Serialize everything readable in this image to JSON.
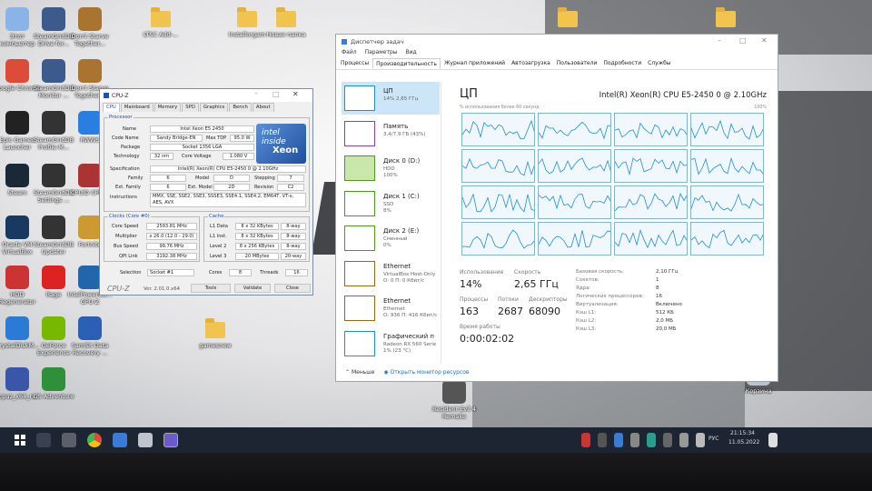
{
  "desktop": {
    "icons": [
      {
        "label": "Этот компьютер",
        "color": "#8ab4e8"
      },
      {
        "label": "SteamGridDB Drive for...",
        "color": "#3c5a8c"
      },
      {
        "label": "Don't Starve Together...",
        "color": "#a8742f"
      },
      {
        "label": "Google Chrome",
        "color": "#dd4b39"
      },
      {
        "label": "SteamGridDB Monitor ...",
        "color": "#3c5a8c"
      },
      {
        "label": "Don't Starve Together...",
        "color": "#a8742f"
      },
      {
        "label": "Epic Games Launcher",
        "color": "#222"
      },
      {
        "label": "SteamGridDB Profile M...",
        "color": "#333"
      },
      {
        "label": "RWWS",
        "color": "#2a7de1"
      },
      {
        "label": "Steam",
        "color": "#1b2838"
      },
      {
        "label": "SteamGridDB Settings ...",
        "color": "#333"
      },
      {
        "label": "CPUID CPU-Z",
        "color": "#a33"
      },
      {
        "label": "Oracle VM VirtualBox",
        "color": "#183a61"
      },
      {
        "label": "SteamGridDB Updater",
        "color": "#333"
      },
      {
        "label": "Fortnite",
        "color": "#c93"
      },
      {
        "label": "HDD Regenerator",
        "color": "#c33"
      },
      {
        "label": "Rage",
        "color": "#d22"
      },
      {
        "label": "IntelPowerGa... GPU-Z",
        "color": "#2266aa"
      },
      {
        "label": "CrystalDiskM...",
        "color": "#2b7bd6"
      },
      {
        "label": "GeForce Experience",
        "color": "#76b900"
      },
      {
        "label": "SamSit Data Recovery ...",
        "color": "#2b5fb5"
      },
      {
        "label": "cpuz_x64_ru",
        "color": "#3a56a8"
      },
      {
        "label": "GS Adventure",
        "color": "#2f8f3a"
      }
    ],
    "folders": [
      {
        "label": "LTSC Add-..."
      },
      {
        "label": "Installorgam"
      },
      {
        "label": "Новая папка"
      },
      {
        "label": "gamesnew"
      }
    ],
    "recycle_label": "Корзина",
    "resident_label": "Resident Evil 4 Remake"
  },
  "cpuz": {
    "title": "CPU-Z",
    "tabs": [
      "CPU",
      "Mainboard",
      "Memory",
      "SPD",
      "Graphics",
      "Bench",
      "About"
    ],
    "processor_legend": "Processor",
    "name": "Intel Xeon E5 2450",
    "code_name": "Sandy Bridge-EN",
    "max_tdp": "95.0 W",
    "package": "Socket 1356 LGA",
    "technology": "32 nm",
    "core_voltage": "1.080 V",
    "specification": "Intel(R) Xeon(R) CPU E5-2450 0 @ 2.10GHz",
    "family": "6",
    "model": "D",
    "stepping": "7",
    "ext_family": "6",
    "ext_model": "2D",
    "revision": "C2",
    "instructions": "MMX, SSE, SSE2, SSE3, SSSE3, SSE4.1, SSE4.2, EM64T, VT-x, AES, AVX",
    "clocks_legend": "Clocks (Core #0)",
    "core_speed": "2593.81 MHz",
    "multiplier": "x 26.0 (12.0 - 29.0)",
    "bus_speed": "99.76 MHz",
    "qpi_link": "3192.38 MHz",
    "cache_legend": "Cache",
    "l1_data": "8 x 32 KBytes",
    "l1_data_way": "8-way",
    "l1_inst": "8 x 32 KBytes",
    "l1_inst_way": "8-way",
    "level2": "8 x 256 KBytes",
    "level2_way": "8-way",
    "level3": "20 MBytes",
    "level3_way": "20-way",
    "selection_label": "Selection",
    "selection": "Socket #1",
    "cores_label": "Cores",
    "cores": "8",
    "threads_label": "Threads",
    "threads": "16",
    "brand": "CPU-Z",
    "version": "Ver. 2.01.0.x64",
    "tools_btn": "Tools",
    "validate_btn": "Validate",
    "close_btn": "Close",
    "labels": {
      "name": "Name",
      "code_name": "Code Name",
      "max_tdp": "Max TDP",
      "package": "Package",
      "technology": "Technology",
      "core_voltage": "Core Voltage",
      "specification": "Specification",
      "family": "Family",
      "model": "Model",
      "stepping": "Stepping",
      "ext_family": "Ext. Family",
      "ext_model": "Ext. Model",
      "revision": "Revision",
      "instructions": "Instructions",
      "core_speed": "Core Speed",
      "multiplier": "Multiplier",
      "bus_speed": "Bus Speed",
      "qpi_link": "QPI Link",
      "l1_data": "L1 Data",
      "l1_inst": "L1 Inst.",
      "level2": "Level 2",
      "level3": "Level 3"
    },
    "badge_top": "intel inside",
    "badge_bottom": "Xeon"
  },
  "taskmgr": {
    "title": "Диспетчер задач",
    "menu": [
      "Файл",
      "Параметры",
      "Вид"
    ],
    "tabs": [
      "Процессы",
      "Производительность",
      "Журнал приложений",
      "Автозагрузка",
      "Пользователи",
      "Подробности",
      "Службы"
    ],
    "sidebar": [
      {
        "t1": "ЦП",
        "t2": "14% 2,65 ГГц",
        "t3": "",
        "color": "#1f8fd1"
      },
      {
        "t1": "Память",
        "t2": "3,4/7,9 ГБ (43%)",
        "t3": "",
        "color": "#8b3fa8"
      },
      {
        "t1": "Диск 0 (D:)",
        "t2": "HDD",
        "t3": "100%",
        "color": "#4d9a1c"
      },
      {
        "t1": "Диск 1 (C:)",
        "t2": "SSD",
        "t3": "8%",
        "color": "#4d9a1c"
      },
      {
        "t1": "Диск 2 (E:)",
        "t2": "Сменный",
        "t3": "0%",
        "color": "#4d9a1c"
      },
      {
        "t1": "Ethernet",
        "t2": "VirtualBox Host-Only",
        "t3": "О: 0 П: 0 Кбит/с",
        "color": "#a36512"
      },
      {
        "t1": "Ethernet",
        "t2": "Ethernet",
        "t3": "О: 936 П: 416 Кбит/с",
        "color": "#a36512"
      },
      {
        "t1": "Графический п",
        "t2": "Radeon RX 560 Serie",
        "t3": "1% (23 °C)",
        "color": "#1f8fd1"
      }
    ],
    "cpu_title": "ЦП",
    "cpu_model": "Intel(R) Xeon(R) CPU E5-2450 0 @ 2.10GHz",
    "util_label": "% использования более 60 секунд",
    "pct_label": "100%",
    "stats": {
      "usage_label": "Использование",
      "usage": "14%",
      "speed_label": "Скорость",
      "speed": "2,65 ГГц",
      "proc_label": "Процессы",
      "proc": "163",
      "threads_label": "Потоки",
      "threads": "2687",
      "handles_label": "Дескрипторы",
      "handles": "68090",
      "uptime_label": "Время работы",
      "uptime": "0:00:02:02"
    },
    "right": [
      {
        "k": "Базовая скорость:",
        "v": "2,10 ГГц"
      },
      {
        "k": "Сокетов:",
        "v": "1"
      },
      {
        "k": "Ядра:",
        "v": "8"
      },
      {
        "k": "Логических процессоров:",
        "v": "16"
      },
      {
        "k": "Виртуализация:",
        "v": "Включено"
      },
      {
        "k": "Кэш L1:",
        "v": "512 КБ"
      },
      {
        "k": "Кэш L2:",
        "v": "2,0 МБ"
      },
      {
        "k": "Кэш L3:",
        "v": "20,0 МБ"
      }
    ],
    "less": "Меньше",
    "open_monitor": "Открыть монитор ресурсов"
  },
  "taskbar": {
    "time": "21:15:34",
    "date": "11.05.2022",
    "lang": "РУС"
  }
}
